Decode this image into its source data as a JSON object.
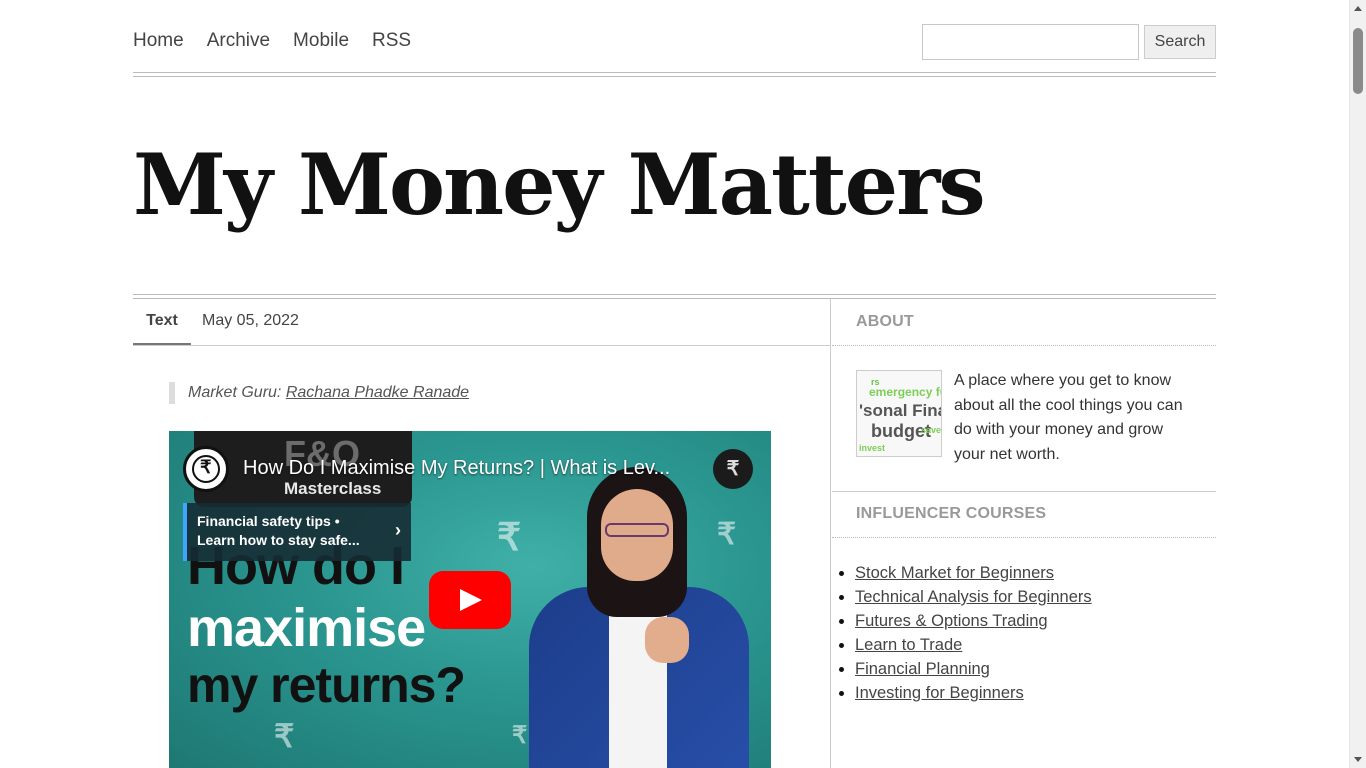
{
  "nav": {
    "items": [
      "Home",
      "Archive",
      "Mobile",
      "RSS"
    ]
  },
  "search": {
    "button_label": "Search",
    "value": ""
  },
  "site": {
    "title": "My Money Matters"
  },
  "post": {
    "tab_label": "Text",
    "date": "May 05, 2022",
    "quote_prefix": "Market Guru:",
    "quote_link": "Rachana Phadke Ranade"
  },
  "video": {
    "title": "How Do I Maximise My Returns? | What is Lev...",
    "fo_big": "F&O",
    "fo_sub": "Masterclass",
    "safety_line1": "Financial safety tips •",
    "safety_line2": "Learn how to stay safe...",
    "big_line1": "How do I",
    "big_line2": "maximise",
    "big_line3": "my returns?",
    "corner_logo": "₹"
  },
  "sidebar": {
    "about_title": "ABOUT",
    "about_text": "A place where you get to know about all the cool things you can do with your money and grow your net worth.",
    "image_words": [
      "emergency fun",
      "'sonal Finar",
      "budget",
      "save",
      "invest",
      "rs"
    ],
    "courses_title": "INFLUENCER COURSES",
    "courses": [
      "Stock Market for Beginners",
      "Technical Analysis for Beginners",
      "Futures & Options Trading",
      "Learn to Trade",
      "Financial Planning",
      "Investing for Beginners"
    ]
  },
  "colors": {
    "play_button": "#ff0000",
    "video_bg": "#2a958f",
    "link": "#444444"
  }
}
